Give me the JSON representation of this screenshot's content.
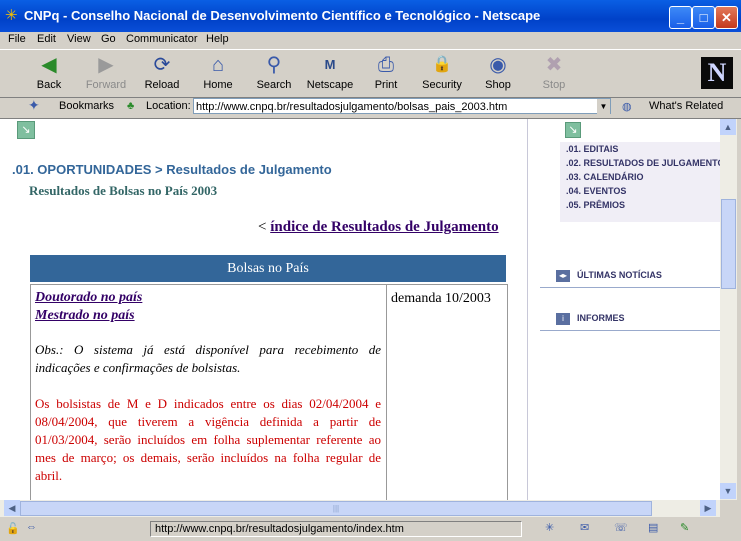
{
  "window": {
    "title": "CNPq - Conselho Nacional de Desenvolvimento Científico e Tecnológico - Netscape",
    "minimize": "_",
    "maximize": "□",
    "close": "✕"
  },
  "menu": [
    "File",
    "Edit",
    "View",
    "Go",
    "Communicator",
    "Help"
  ],
  "toolbar": {
    "items": [
      {
        "label": "Back",
        "icon": "back-arrow-icon",
        "glyph": "◀"
      },
      {
        "label": "Forward",
        "icon": "forward-arrow-icon",
        "glyph": "▶"
      },
      {
        "label": "Reload",
        "icon": "reload-icon",
        "glyph": "⟳"
      },
      {
        "label": "Home",
        "icon": "home-icon",
        "glyph": "⌂"
      },
      {
        "label": "Search",
        "icon": "search-icon",
        "glyph": "⚲"
      },
      {
        "label": "Netscape",
        "icon": "netscape-icon",
        "glyph": "M"
      },
      {
        "label": "Print",
        "icon": "print-icon",
        "glyph": "⎙"
      },
      {
        "label": "Security",
        "icon": "lock-icon",
        "glyph": "🔒"
      },
      {
        "label": "Shop",
        "icon": "shop-icon",
        "glyph": "◉"
      },
      {
        "label": "Stop",
        "icon": "stop-icon",
        "glyph": "✖"
      }
    ],
    "logo": "N"
  },
  "location": {
    "bookmarks": "Bookmarks",
    "label": "Location:",
    "url": "http://www.cnpq.br/resultadosjulgamento/bolsas_pais_2003.htm",
    "whats_related": "What's Related"
  },
  "page": {
    "breadcrumb": ".01. OPORTUNIDADES > Resultados de Julgamento",
    "subtitle": "Resultados de Bolsas no País 2003",
    "index_link_prefix": "< ",
    "index_link": "índice de Resultados de Julgamento",
    "table_title": "Bolsas no País",
    "links": [
      "Doutorado no país",
      "Mestrado no país"
    ],
    "obs": "Obs.: O sistema já está disponível para recebimento de indicações e confirmações de bolsistas.",
    "notice": "Os bolsistas de M e D indicados entre os dias 02/04/2004 e 08/04/2004, que tiverem a vigência definida a partir de 01/03/2004, serão incluídos em folha suplementar referente ao mes de março; os demais, serão incluídos na folha regular de abril.",
    "demanda": "demanda 10/2003"
  },
  "sidebar": {
    "menu": [
      ".01. EDITAIS",
      ".02. RESULTADOS DE JULGAMENTO",
      ".03. CALENDÁRIO",
      ".04. EVENTOS",
      ".05. PRÊMIOS"
    ],
    "news": "ÚLTIMAS NOTÍCIAS",
    "info": "INFORMES"
  },
  "status": {
    "url": "http://www.cnpq.br/resultadosjulgamento/index.htm"
  },
  "colors": {
    "accent": "#336699",
    "notice": "#cc0000",
    "link": "#330066"
  }
}
